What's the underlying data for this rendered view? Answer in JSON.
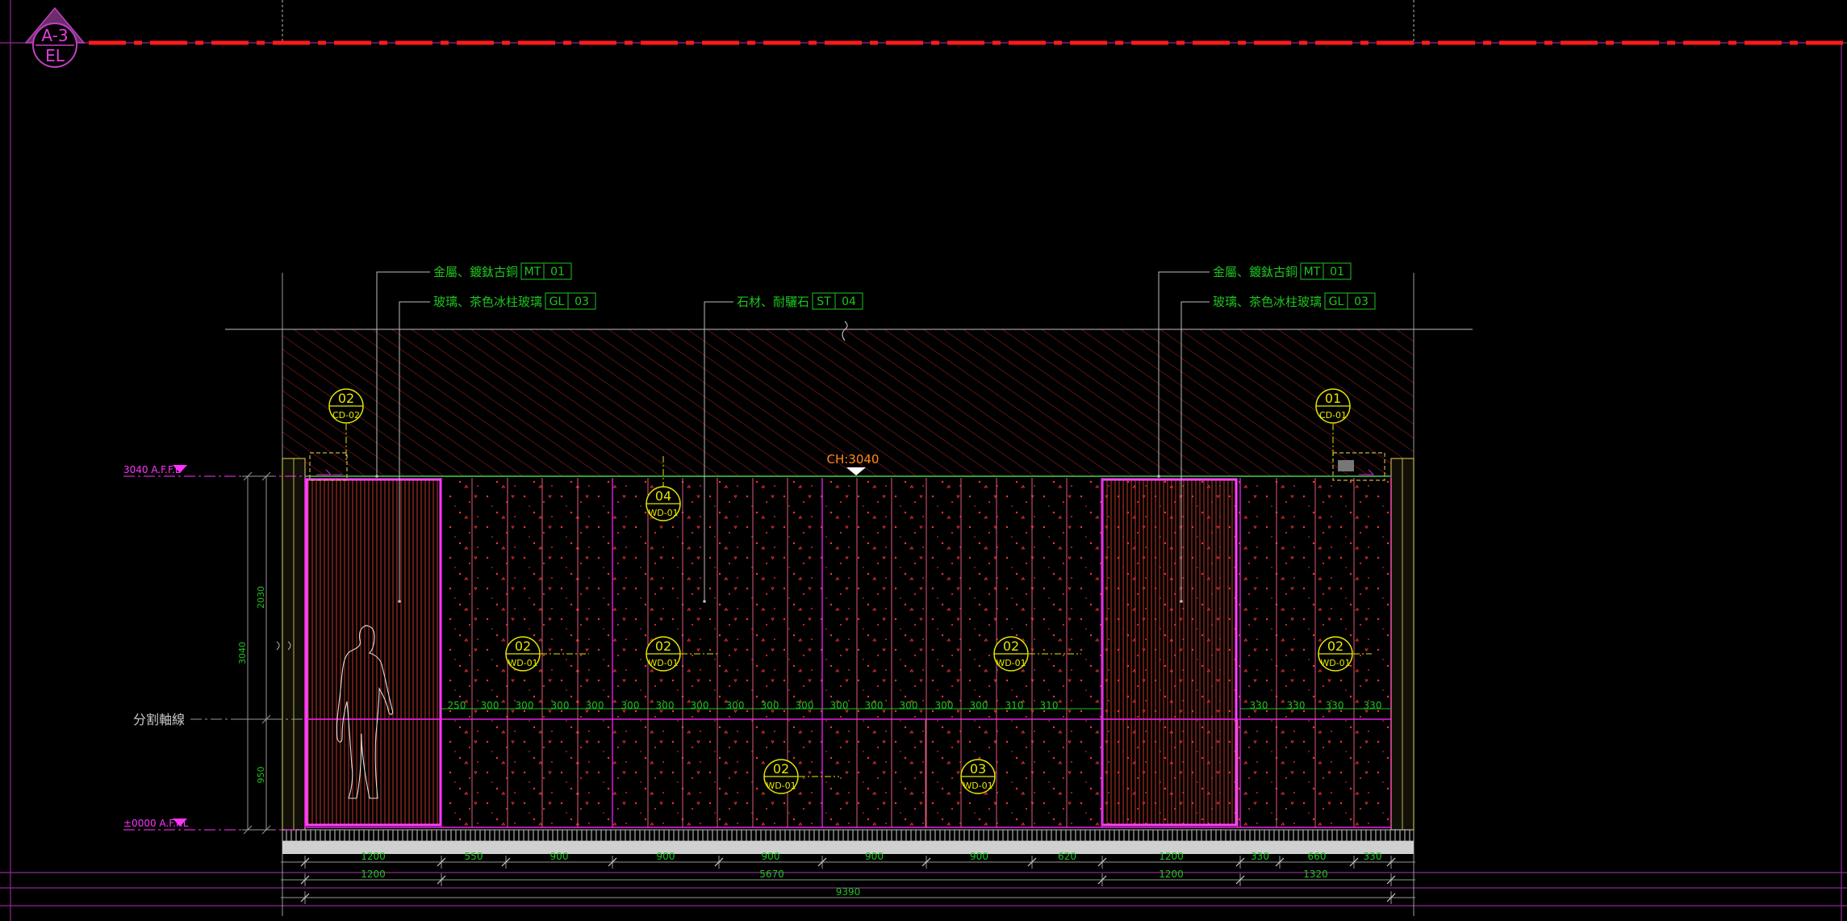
{
  "sheet": {
    "drawing_number": "A-3",
    "drawing_type": "EL"
  },
  "materials": [
    {
      "text": "金屬、鍍鈦古銅",
      "code": "MT",
      "num": "01"
    },
    {
      "text": "玻璃、茶色冰柱玻璃",
      "code": "GL",
      "num": "03"
    },
    {
      "text": "石材、耐驪石",
      "code": "ST",
      "num": "04"
    },
    {
      "text": "金屬、鍍鈦古銅",
      "code": "MT",
      "num": "01"
    },
    {
      "text": "玻璃、茶色冰柱玻璃",
      "code": "GL",
      "num": "03"
    }
  ],
  "ceiling_height": "CH:3040",
  "levels": {
    "top": "3040 A.F.F.L",
    "bottom": "±0000 A.F.F.L",
    "split_axis": "分割軸線"
  },
  "vertical_dims": {
    "upper": "2030",
    "total": "3040",
    "lower": "950"
  },
  "callouts": [
    {
      "num": "02",
      "ref": "CD-02"
    },
    {
      "num": "01",
      "ref": "CD-01"
    },
    {
      "num": "04",
      "ref": "WD-01"
    },
    {
      "num": "02",
      "ref": "WD-01"
    },
    {
      "num": "02",
      "ref": "WD-01"
    },
    {
      "num": "02",
      "ref": "WD-01"
    },
    {
      "num": "02",
      "ref": "WD-01"
    },
    {
      "num": "02",
      "ref": "WD-01"
    },
    {
      "num": "03",
      "ref": "WD-01"
    }
  ],
  "panel_dims": [
    "250",
    "300",
    "300",
    "300",
    "300",
    "300",
    "300",
    "300",
    "300",
    "300",
    "300",
    "300",
    "300",
    "300",
    "300",
    "300",
    "310",
    "310",
    "330",
    "330",
    "330",
    "330"
  ],
  "bottom_dims": {
    "row1": [
      "1200",
      "550",
      "900",
      "900",
      "900",
      "900",
      "900",
      "620",
      "1200",
      "330",
      "660",
      "330"
    ],
    "row2": [
      "1200",
      "5670",
      "1200",
      "1320"
    ],
    "row3": [
      "9390"
    ]
  }
}
